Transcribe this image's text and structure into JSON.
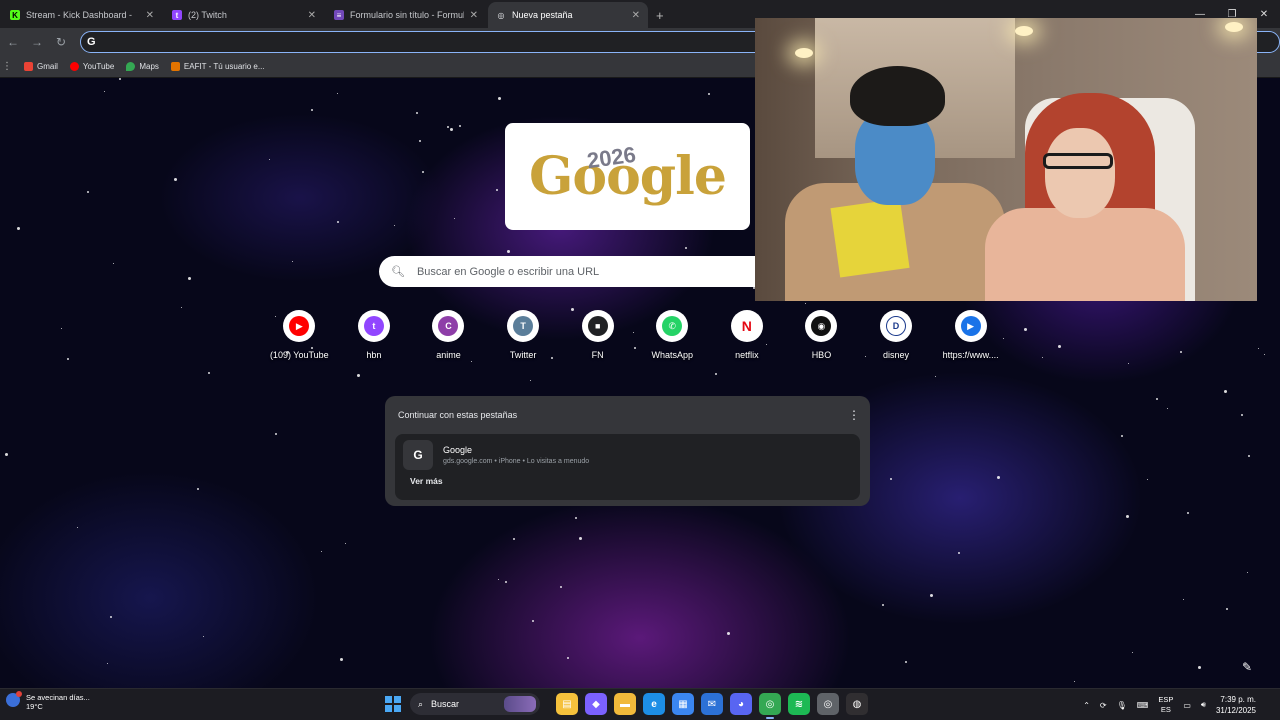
{
  "browser": {
    "tabs": [
      {
        "title": "Stream - Kick Dashboard -",
        "favicon": "kick-icon",
        "color": "#53fc18",
        "glyph": "K",
        "active": false
      },
      {
        "title": "(2) Twitch",
        "favicon": "twitch-icon",
        "color": "#9146ff",
        "glyph": "t",
        "active": false
      },
      {
        "title": "Formulario sin título - Formula",
        "favicon": "forms-icon",
        "color": "#7248b9",
        "glyph": "≡",
        "active": false
      },
      {
        "title": "Nueva pestaña",
        "favicon": "chrome-icon",
        "color": "#e8eaed",
        "glyph": "◎",
        "active": true
      }
    ],
    "new_tab_symbol": "+",
    "omnibox": {
      "value": "",
      "placeholder": ""
    },
    "bookmarks": [
      {
        "label": "Gmail",
        "icon": "gmail-icon",
        "color": "#ea4335"
      },
      {
        "label": "YouTube",
        "icon": "youtube-icon",
        "color": "#ff0000"
      },
      {
        "label": "Maps",
        "icon": "maps-icon",
        "color": "#34a853"
      },
      {
        "label": "EAFIT - Tú usuario e...",
        "icon": "eafit-icon",
        "color": "#e37400"
      }
    ]
  },
  "new_tab_page": {
    "doodle": {
      "text": "Google",
      "year": "2026"
    },
    "search": {
      "placeholder": "Buscar en Google o escribir una URL"
    },
    "shortcuts": [
      {
        "label": "(109) YouTube",
        "icon": "youtube-icon",
        "color": "#ff0000",
        "glyph": "▶"
      },
      {
        "label": "hbn",
        "icon": "twitch-icon",
        "color": "#9146ff",
        "glyph": "t"
      },
      {
        "label": "anime",
        "icon": "letter-c-icon",
        "color": "#8e3ea8",
        "glyph": "C"
      },
      {
        "label": "Twitter",
        "icon": "letter-t-icon",
        "color": "#5b7e9a",
        "glyph": "T"
      },
      {
        "label": "FN",
        "icon": "fn-icon",
        "color": "#202124",
        "glyph": "■"
      },
      {
        "label": "WhatsApp",
        "icon": "whatsapp-icon",
        "color": "#25d366",
        "glyph": "✆"
      },
      {
        "label": "netflix",
        "icon": "netflix-icon",
        "color": "#e50914",
        "glyph": "N"
      },
      {
        "label": "HBO",
        "icon": "hbo-icon",
        "color": "#111111",
        "glyph": "◉"
      },
      {
        "label": "disney",
        "icon": "disney-icon",
        "color": "#1b3a8c",
        "glyph": "D"
      },
      {
        "label": "https://www....",
        "icon": "play-icon",
        "color": "#1a73e8",
        "glyph": "▶"
      }
    ],
    "continue_card": {
      "heading": "Continuar con estas pestañas",
      "item_title": "Google",
      "item_detail": "gds.google.com • iPhone • Lo visitas a menudo",
      "more_label": "Ver más"
    }
  },
  "taskbar": {
    "weather": {
      "title": "Se avecinan días...",
      "temp": "19°C"
    },
    "search_label": "Buscar",
    "language": {
      "top": "ESP",
      "bottom": "ES"
    },
    "time": "7:39 p. m.",
    "date": "31/12/2025",
    "apps": [
      {
        "name": "file-explorer-icon",
        "color": "#f5c13c",
        "glyph": "▤"
      },
      {
        "name": "copilot-icon",
        "color": "#7b61ff",
        "glyph": "◆"
      },
      {
        "name": "folder-icon",
        "color": "#f1b93b",
        "glyph": "▬"
      },
      {
        "name": "edge-icon",
        "color": "#1d8ee6",
        "glyph": "e"
      },
      {
        "name": "store-icon",
        "color": "#3b86f0",
        "glyph": "▦"
      },
      {
        "name": "mail-icon",
        "color": "#2c71d6",
        "glyph": "✉"
      },
      {
        "name": "discord-icon",
        "color": "#5865f2",
        "glyph": "◕"
      },
      {
        "name": "chrome-icon",
        "color": "#34a853",
        "glyph": "◎",
        "active": true
      },
      {
        "name": "spotify-icon",
        "color": "#1db954",
        "glyph": "≋"
      },
      {
        "name": "chrome-alt-icon",
        "color": "#5f6368",
        "glyph": "◎"
      },
      {
        "name": "obs-icon",
        "color": "#302e31",
        "glyph": "◍"
      }
    ]
  }
}
